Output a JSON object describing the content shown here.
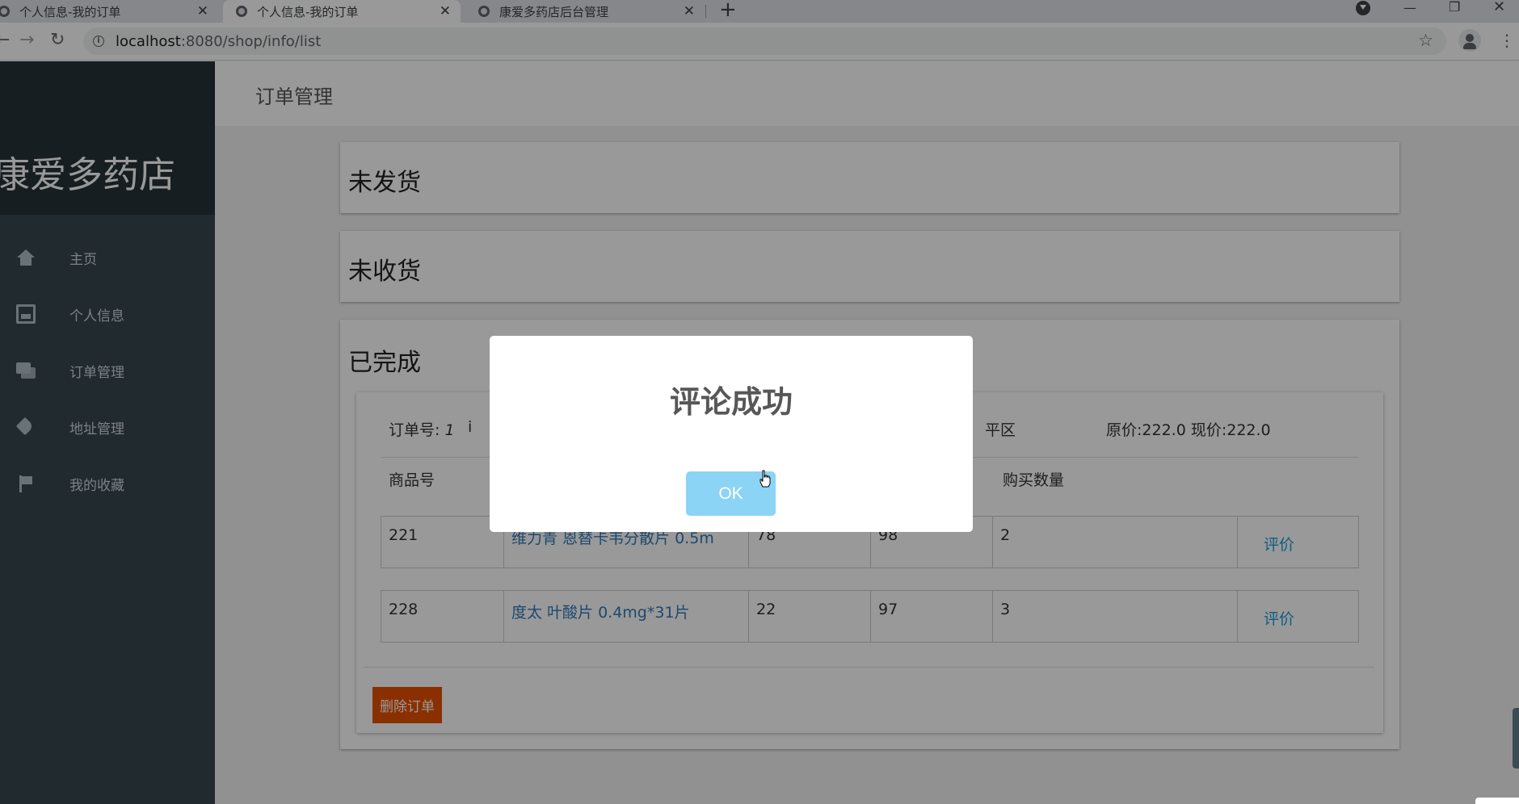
{
  "browser": {
    "tabs": [
      {
        "title": "个人信息-我的订单"
      },
      {
        "title": "个人信息-我的订单"
      },
      {
        "title": "康爱多药店后台管理"
      }
    ],
    "url_host": "localhost",
    "url_rest": ":8080/shop/info/list"
  },
  "sidebar": {
    "brand": "康爱多药店",
    "items": [
      {
        "label": "主页",
        "icon": "home-icon"
      },
      {
        "label": "个人信息",
        "icon": "inbox-icon"
      },
      {
        "label": "订单管理",
        "icon": "chat-icon"
      },
      {
        "label": "地址管理",
        "icon": "tag-icon"
      },
      {
        "label": "我的收藏",
        "icon": "flag-icon"
      }
    ]
  },
  "header": {
    "title": "订单管理"
  },
  "sections": {
    "unshipped": "未发货",
    "unreceived": "未收货",
    "completed": "已完成"
  },
  "order": {
    "order_no_label": "订单号:",
    "order_no": "1",
    "header_mid_left": "i",
    "header_mid_right": "平区",
    "prices": "原价:222.0 现价:222.0",
    "columns": [
      "商品号",
      "购买数量"
    ],
    "rows": [
      {
        "id": "221",
        "name": "维力青 恩替卡韦分散片 0.5m",
        "col3": "78",
        "col4": "98",
        "qty": "2",
        "action": "评价"
      },
      {
        "id": "228",
        "name": "度太 叶酸片 0.4mg*31片",
        "col3": "22",
        "col4": "97",
        "qty": "3",
        "action": "评价"
      }
    ],
    "delete_label": "删除订单"
  },
  "modal": {
    "title": "评论成功",
    "ok_label": "OK"
  },
  "colors": {
    "sidebar": "#37474f",
    "brand_bg": "#263238",
    "delete_btn": "#e65100",
    "ok_btn": "#8cd4f5"
  }
}
